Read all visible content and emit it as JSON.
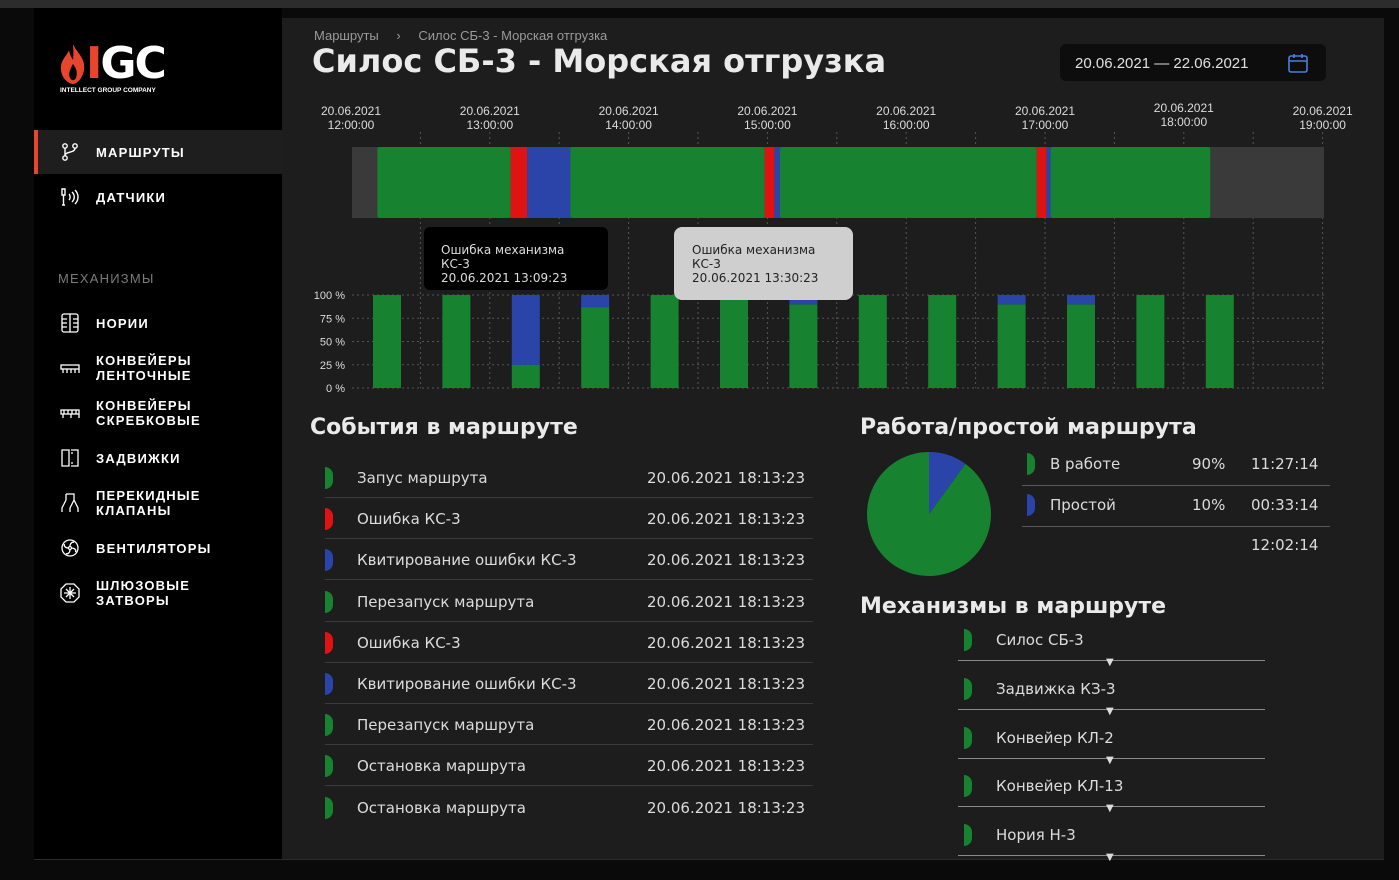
{
  "colors": {
    "work": "#178230",
    "error": "#e01313",
    "ack": "#2b44aa",
    "idle": "#3a3a3a",
    "accent": "#e8452e"
  },
  "logo": {
    "brand_prefix": "I",
    "brand_rest": "GC",
    "subtitle": "INTELLECT GROUP COMPANY"
  },
  "nav": {
    "top": [
      {
        "label": "МАРШРУТЫ",
        "icon": "route-icon",
        "active": true
      },
      {
        "label": "ДАТЧИКИ",
        "icon": "sensor-icon",
        "active": false
      }
    ],
    "section_label": "МЕХАНИЗМЫ",
    "mechanisms": [
      {
        "line1": "НОРИИ",
        "line2": "",
        "icon": "bucket-elevator-icon"
      },
      {
        "line1": "КОНВЕЙЕРЫ",
        "line2": "ЛЕНТОЧНЫЕ",
        "icon": "belt-conveyor-icon"
      },
      {
        "line1": "КОНВЕЙЕРЫ",
        "line2": "СКРЕБКОВЫЕ",
        "icon": "scraper-conveyor-icon"
      },
      {
        "line1": "ЗАДВИЖКИ",
        "line2": "",
        "icon": "gate-valve-icon"
      },
      {
        "line1": "ПЕРЕКИДНЫЕ",
        "line2": "КЛАПАНЫ",
        "icon": "diverter-valve-icon"
      },
      {
        "line1": "ВЕНТИЛЯТОРЫ",
        "line2": "",
        "icon": "fan-icon"
      },
      {
        "line1": "ШЛЮЗОВЫЕ",
        "line2": "ЗАТВОРЫ",
        "icon": "rotary-valve-icon"
      }
    ]
  },
  "breadcrumb": {
    "root": "Маршруты",
    "separator": "›",
    "current": "Силос СБ-3 - Морская отгрузка"
  },
  "page_title": "Силос СБ-3 - Морская отгрузка",
  "date_range": "20.06.2021 — 22.06.2021",
  "timeline": {
    "ticks": [
      {
        "date": "20.06.2021",
        "time": "12:00:00"
      },
      {
        "date": "20.06.2021",
        "time": "13:00:00"
      },
      {
        "date": "20.06.2021",
        "time": "14:00:00"
      },
      {
        "date": "20.06.2021",
        "time": "15:00:00"
      },
      {
        "date": "20.06.2021",
        "time": "16:00:00"
      },
      {
        "date": "20.06.2021",
        "time": "17:00:00"
      },
      {
        "date": "20.06.2021",
        "time": "18:00:00"
      },
      {
        "date": "20.06.2021",
        "time": "19:00:00"
      }
    ],
    "segments": [
      {
        "start_h": 12.19,
        "end_h": 13.15,
        "state": "work"
      },
      {
        "start_h": 13.15,
        "end_h": 13.27,
        "state": "error"
      },
      {
        "start_h": 13.27,
        "end_h": 13.58,
        "state": "ack"
      },
      {
        "start_h": 13.58,
        "end_h": 14.98,
        "state": "work"
      },
      {
        "start_h": 14.98,
        "end_h": 15.05,
        "state": "error"
      },
      {
        "start_h": 15.05,
        "end_h": 15.09,
        "state": "ack"
      },
      {
        "start_h": 15.09,
        "end_h": 16.94,
        "state": "work"
      },
      {
        "start_h": 16.94,
        "end_h": 17.01,
        "state": "error"
      },
      {
        "start_h": 17.01,
        "end_h": 17.04,
        "state": "ack"
      },
      {
        "start_h": 17.04,
        "end_h": 18.19,
        "state": "work"
      }
    ],
    "tooltips": [
      {
        "title": "Ошибка механизма",
        "mechanism": "КС-3",
        "time": "20.06.2021 13:09:23",
        "theme": "dark"
      },
      {
        "title": "Ошибка механизма",
        "mechanism": "КС-3",
        "time": "20.06.2021 13:30:23",
        "theme": "light"
      }
    ]
  },
  "chart_data": {
    "type": "bar",
    "y_ticks": [
      "100 %",
      "75 %",
      "50 %",
      "25 %",
      "0 %"
    ],
    "ylim": [
      0,
      100
    ],
    "series": [
      {
        "name": "work",
        "values": [
          100,
          100,
          25,
          87,
          100,
          100,
          90,
          100,
          100,
          90,
          90,
          100,
          100
        ]
      },
      {
        "name": "ack",
        "values": [
          0,
          0,
          75,
          13,
          0,
          0,
          10,
          0,
          0,
          10,
          10,
          0,
          0
        ]
      }
    ]
  },
  "events": {
    "title": "События в маршруте",
    "rows": [
      {
        "name": "Запус маршрута",
        "time": "20.06.2021 18:13:23",
        "state": "work"
      },
      {
        "name": "Ошибка КС-3",
        "time": "20.06.2021 18:13:23",
        "state": "error"
      },
      {
        "name": "Квитирование ошибки КС-3",
        "time": "20.06.2021 18:13:23",
        "state": "ack"
      },
      {
        "name": "Перезапуск маршрута",
        "time": "20.06.2021 18:13:23",
        "state": "work"
      },
      {
        "name": "Ошибка КС-3",
        "time": "20.06.2021 18:13:23",
        "state": "error"
      },
      {
        "name": "Квитирование ошибки КС-3",
        "time": "20.06.2021 18:13:23",
        "state": "ack"
      },
      {
        "name": "Перезапуск маршрута",
        "time": "20.06.2021 18:13:23",
        "state": "work"
      },
      {
        "name": "Остановка маршрута",
        "time": "20.06.2021 18:13:23",
        "state": "work"
      },
      {
        "name": "Остановка маршрута",
        "time": "20.06.2021 18:13:23",
        "state": "work"
      }
    ]
  },
  "work_idle": {
    "title": "Работа/простой маршрута",
    "rows": [
      {
        "name": "В работе",
        "percent": "90%",
        "value": 90,
        "duration": "11:27:14",
        "state": "work"
      },
      {
        "name": "Простой",
        "percent": "10%",
        "value": 10,
        "duration": "00:33:14",
        "state": "ack"
      }
    ],
    "total": "12:02:14"
  },
  "mechanisms": {
    "title": "Механизмы в маршруте",
    "items": [
      "Силос СБ-3",
      "Задвижка КЗ-3",
      "Конвейер КЛ-2",
      "Конвейер КЛ-13",
      "Нория Н-3"
    ],
    "arrow": "▼"
  }
}
